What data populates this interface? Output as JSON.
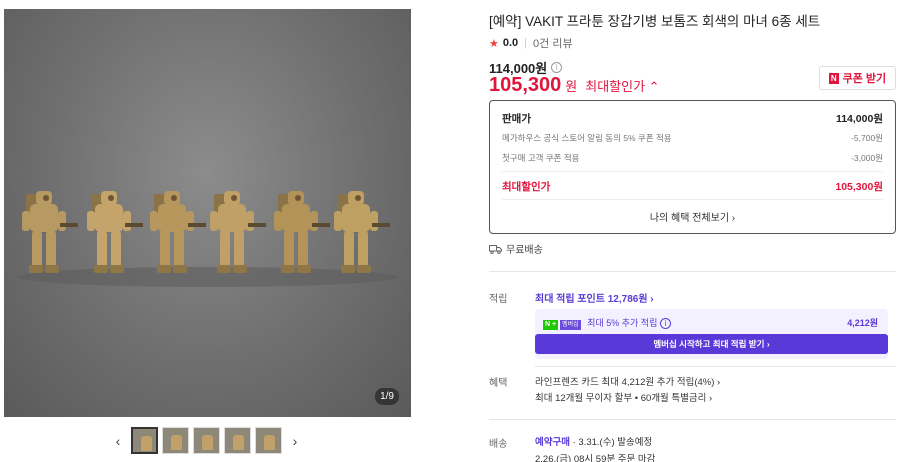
{
  "gallery": {
    "counter": "1/9",
    "prev_icon": "‹",
    "next_icon": "›",
    "thumbnail_count": 5
  },
  "product": {
    "title": "[예약] VAKIT 프라툰 장갑기병 보톰즈 회색의 마녀 6종 세트",
    "rating": "0.0",
    "reviews": "0건 리뷰",
    "original_price": "114,000원",
    "sale_price": "105,300",
    "sale_unit": "원",
    "sale_label": "최대할인가 ⌃",
    "coupon_badge": "N",
    "coupon_label": "쿠폰 받기"
  },
  "pricebox": {
    "sell_label": "판매가",
    "sell_value": "114,000원",
    "disc1_label": "메가하우스 공식 스토어 알림 동의 5% 쿠폰 적용",
    "disc1_value": "-5,700원",
    "disc2_label": "첫구매 고객 쿠폰 적용",
    "disc2_value": "-3,000원",
    "max_label": "최대할인가",
    "max_value": "105,300원",
    "all_benefits": "나의 혜택 전체보기 ›"
  },
  "shipping": {
    "label": "무료배송"
  },
  "points": {
    "section_label": "적립",
    "max_points": "최대 적립 포인트 12,786원 ›",
    "np_plus": "N +",
    "np_badge": "멤버십",
    "np_text": "최대 5% 추가 적립",
    "np_amount": "4,212원",
    "np_button": "멤버십 시작하고 최대 적립 받기 ›"
  },
  "benefits": {
    "section_label": "혜택",
    "line1": "라인프렌즈 카드 최대 4,212원 추가 적립(4%) ›",
    "line2": "최대 12개월 무이자 할부 • 60개월 특별금리 ›"
  },
  "delivery": {
    "section_label": "배송",
    "preorder": "예약구매",
    "ship_date": " · 3.31.(수) 발송예정",
    "deadline": "2.26.(금) 08시 59분 주문 마감"
  },
  "colors": {
    "accent_red": "#e0163d",
    "accent_purple": "#5b38d8"
  }
}
